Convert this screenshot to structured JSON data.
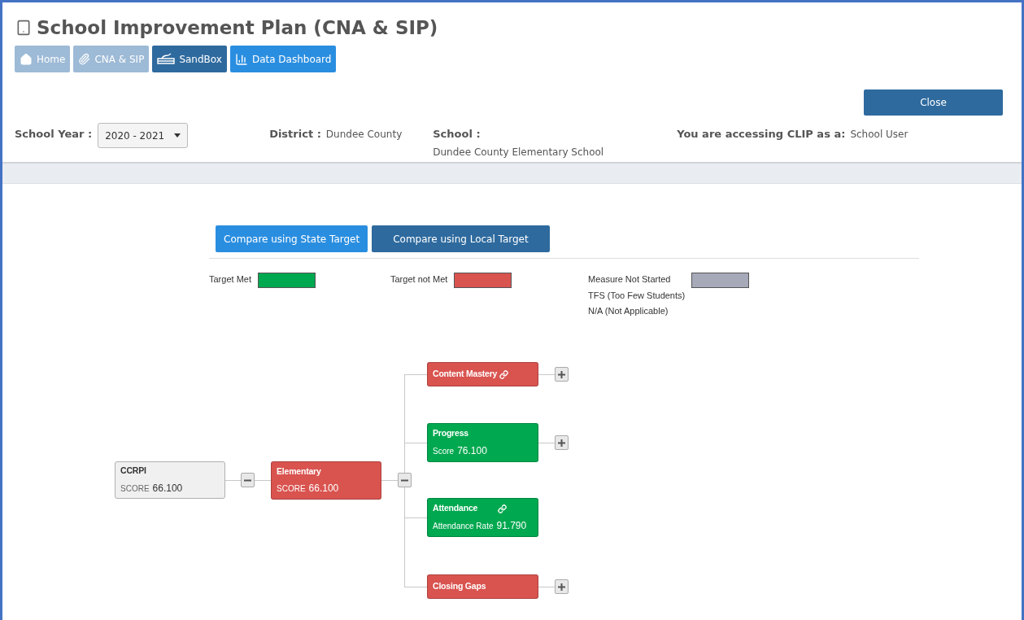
{
  "title": "School Improvement Plan (CNA & SIP)",
  "nav": [
    {
      "label": "Home",
      "kind": "muted"
    },
    {
      "label": "CNA & SIP",
      "kind": "muted"
    },
    {
      "label": "SandBox",
      "kind": "dark"
    },
    {
      "label": "Data Dashboard",
      "kind": "primary"
    }
  ],
  "close_button": "Close",
  "filters": {
    "school_year_label": "School Year :",
    "school_year": "2020 - 2021",
    "district_label": "District :",
    "district": "Dundee County",
    "school_label": "School :",
    "school": "Dundee County Elementary School",
    "role_label": "You are accessing CLIP as a:",
    "role": "School User"
  },
  "compare_buttons": [
    {
      "label": "Compare using State Target",
      "selected": true
    },
    {
      "label": "Compare using Local Target",
      "selected": false
    }
  ],
  "legend": [
    {
      "lines": [
        "Target Met"
      ],
      "color": "#00a84f"
    },
    {
      "lines": [
        "Target not Met"
      ],
      "color": "#d9534f"
    },
    {
      "lines": [
        "Measure Not Started",
        "TFS (Too Few Students)",
        "N/A (Not Applicable)"
      ],
      "color": "#a5a9b8"
    }
  ],
  "tree": {
    "label": "CCRPI",
    "score_label": "SCORE",
    "score": "66.100",
    "color": "#f0f0f0",
    "linked": false,
    "collapsible": true,
    "expanded": true,
    "children": [
      {
        "label": "Elementary",
        "score_label": "SCORE",
        "score": "66.100",
        "color": "#d9534f",
        "linked": false,
        "collapsible": true,
        "expanded": true,
        "children": [
          {
            "label": "Content Mastery",
            "color": "#d9534f",
            "linked": true,
            "collapsible": true,
            "expanded": false
          },
          {
            "label": "Progress",
            "score_label": "Score",
            "score": "76.100",
            "color": "#00a84f",
            "linked": false,
            "collapsible": true,
            "expanded": false
          },
          {
            "label": "Attendance",
            "score_label": "Attendance Rate",
            "score": "91.790",
            "color": "#00a84f",
            "linked": true,
            "collapsible": false
          },
          {
            "label": "Closing Gaps",
            "color": "#d9534f",
            "linked": false,
            "collapsible": true,
            "expanded": false
          }
        ]
      }
    ]
  }
}
